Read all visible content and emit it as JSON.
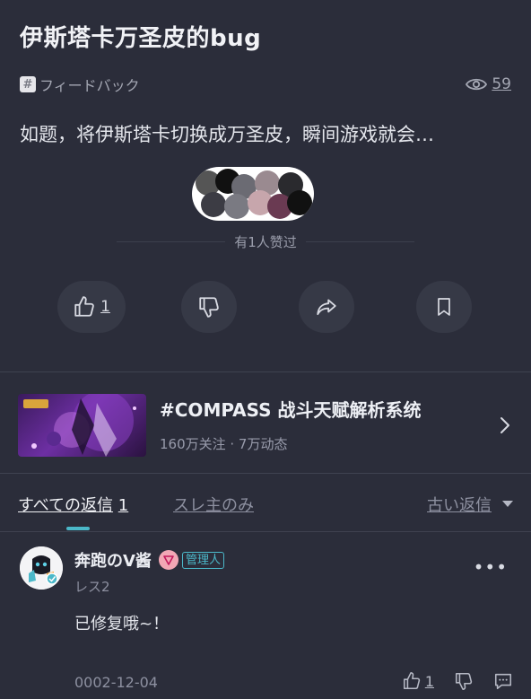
{
  "post": {
    "title": "伊斯塔卡万圣皮的bug",
    "tag_icon": "#",
    "tag": "フィードバック",
    "views": "59",
    "excerpt": "如题，将伊斯塔卡切换成万圣皮，瞬间游戏就会…",
    "liked_by": "有1人赞过",
    "like_count": "1"
  },
  "topic": {
    "title": "#COMPASS 战斗天赋解析系统",
    "subtitle": "160万关注 · 7万动态"
  },
  "tabs": {
    "all_label": "すべての返信",
    "all_count": "1",
    "op_only": "スレ主のみ",
    "sort": "古い返信"
  },
  "reply": {
    "author": "奔跑のV酱",
    "role": "管理人",
    "floor": "レス2",
    "more": "•••",
    "text": "已修复哦~！",
    "date": "0002-12-04",
    "like_count": "1"
  },
  "colors": {
    "background": "#2b2d3a",
    "accent": "#4bb8c9",
    "badge_pink": "#f2a7b5"
  },
  "icons": [
    "eye-icon",
    "hash-icon",
    "thumbs-up-icon",
    "thumbs-down-icon",
    "share-icon",
    "bookmark-icon",
    "chevron-right-icon",
    "caret-down-icon",
    "comment-icon",
    "more-icon"
  ]
}
